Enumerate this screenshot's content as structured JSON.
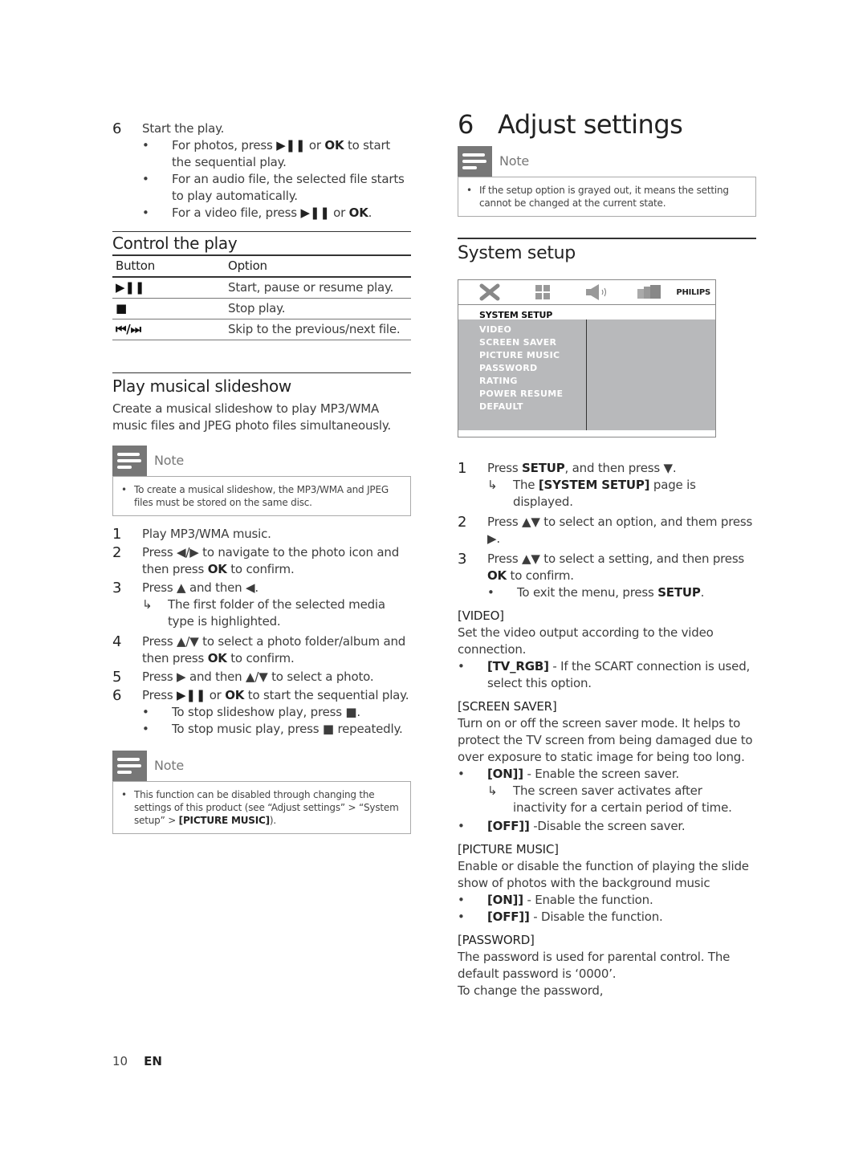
{
  "left": {
    "intro_step": {
      "num": "6",
      "text": "Start the play.",
      "bullets": [
        {
          "pre": "For photos, press ",
          "key": "▶❚❚",
          "mid": " or ",
          "key2": "OK",
          "post": " to start the sequential play."
        },
        {
          "text": "For an audio file, the selected file starts to play automatically."
        },
        {
          "pre": "For a video file, press ",
          "key": "▶❚❚",
          "mid": " or ",
          "key2": "OK",
          "post": "."
        }
      ]
    },
    "control": {
      "heading": "Control the play",
      "columns": [
        "Button",
        "Option"
      ],
      "rows": [
        {
          "button": "▶❚❚",
          "option": "Start, pause or resume play."
        },
        {
          "button": "■",
          "option": "Stop play."
        },
        {
          "button": "⏮/⏭",
          "option": "Skip to the previous/next file."
        }
      ]
    },
    "slideshow": {
      "heading": "Play musical slideshow",
      "intro": "Create a musical slideshow to play MP3/WMA music files and JPEG photo files simultaneously.",
      "note1": {
        "title": "Note",
        "text": "To create a musical slideshow, the MP3/WMA and JPEG files must be stored on the same disc."
      },
      "steps": [
        {
          "num": "1",
          "text": "Play MP3/WMA music."
        },
        {
          "num": "2",
          "pre": "Press ◀/▶ to navigate to the photo icon and then press ",
          "key": "OK",
          "post": " to confirm."
        },
        {
          "num": "3",
          "text": "Press ▲ and then ◀.",
          "result": "The first folder of the selected media type is highlighted."
        },
        {
          "num": "4",
          "pre": "Press ▲/▼ to select a photo folder/album and then press ",
          "key": "OK",
          "post": " to confirm."
        },
        {
          "num": "5",
          "text": "Press ▶ and then ▲/▼ to select a photo."
        },
        {
          "num": "6",
          "pre": "Press ",
          "key": "▶❚❚",
          "mid": " or ",
          "key2": "OK",
          "post": " to start the sequential play."
        }
      ],
      "step6_bullets": [
        "To stop slideshow play, press ■.",
        "To stop music play, press ■ repeatedly."
      ],
      "note2": {
        "title": "Note",
        "pre": "This function can be disabled through changing the settings of this product (see “Adjust settings” > “System setup” > ",
        "key": "[PICTURE MUSIC]",
        "post": ")."
      }
    }
  },
  "right": {
    "chapter_num": "6",
    "chapter_title": "Adjust settings",
    "note": {
      "title": "Note",
      "text": "If the setup option is grayed out, it means the setting cannot be changed at the current state."
    },
    "section": "System setup",
    "osd": {
      "icons": [
        "tools-icon",
        "grid-icon",
        "speaker-icon",
        "screens-icon"
      ],
      "brand": "PHILIPS",
      "title": "SYSTEM  SETUP",
      "menu": [
        "VIDEO",
        "SCREEN  SAVER",
        "PICTURE  MUSIC",
        "PASSWORD",
        "RATING",
        "POWER  RESUME",
        "DEFAULT"
      ],
      "colors": {
        "panel": "#b8b9bb",
        "text": "#ffffff"
      }
    },
    "steps": [
      {
        "num": "1",
        "pre": "Press ",
        "key": "SETUP",
        "post": ", and then press ▼.",
        "result_pre": "The ",
        "result_key": "[SYSTEM SETUP]",
        "result_post": " page is displayed."
      },
      {
        "num": "2",
        "text": "Press ▲▼ to select an option, and them press ▶."
      },
      {
        "num": "3",
        "pre": "Press ▲▼ to select a setting, and then press ",
        "key": "OK",
        "post": " to confirm.",
        "bullet_pre": "To exit the menu, press ",
        "bullet_key": "SETUP",
        "bullet_post": "."
      }
    ],
    "video": {
      "heading": "[VIDEO]",
      "desc": "Set the video output according to the video connection.",
      "opt_key": "[TV_RGB]",
      "opt_text": " - If the SCART connection is used, select this option."
    },
    "screen_saver": {
      "heading": "[SCREEN SAVER]",
      "desc": "Turn on or off the screen saver mode. It helps to protect the TV screen from being damaged due to over exposure to static image for being too long.",
      "on_key": "[ON]]",
      "on_text": " - Enable the screen saver.",
      "on_result": "The screen saver activates after inactivity for a certain period of time.",
      "off_key": "[OFF]]",
      "off_text": " -Disable the screen saver."
    },
    "picture_music": {
      "heading": "[PICTURE MUSIC]",
      "desc": "Enable or disable the function of playing the slide show of photos with the background music",
      "on_key": "[ON]]",
      "on_text": " - Enable the function.",
      "off_key": "[OFF]]",
      "off_text": " - Disable the function."
    },
    "password": {
      "heading": "[PASSWORD]",
      "desc": "The password is used for parental control. The default password is ‘0000’.",
      "desc2": "To change the password,"
    }
  },
  "footer": {
    "page": "10",
    "lang": "EN"
  }
}
